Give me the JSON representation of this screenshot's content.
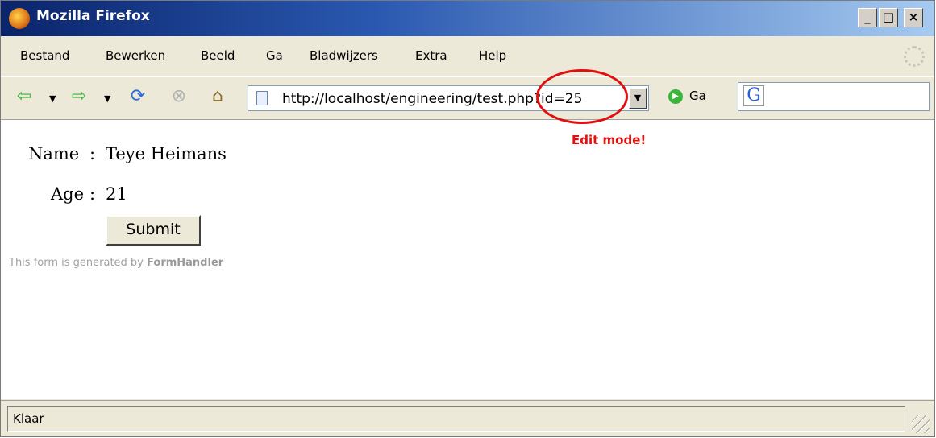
{
  "window": {
    "title": "Mozilla Firefox",
    "controls": {
      "minimize": "_",
      "maximize": "□",
      "close": "×"
    }
  },
  "menubar": {
    "items": [
      "Bestand",
      "Bewerken",
      "Beeld",
      "Ga",
      "Bladwijzers",
      "Extra",
      "Help"
    ]
  },
  "navbar": {
    "url": "http://localhost/engineering/test.php?id=25",
    "go_label": "Ga",
    "icons": [
      "back-icon",
      "forward-icon",
      "reload-icon",
      "stop-icon",
      "home-icon",
      "page-icon",
      "go-icon",
      "google-icon"
    ]
  },
  "form": {
    "name_label": "Name",
    "name_value": "Teye Heimans",
    "age_label": "Age",
    "age_value": "21",
    "separator": ":",
    "submit_label": "Submit",
    "generated_text": "This form is generated by",
    "generated_link": "FormHandler"
  },
  "annotation": {
    "text": "Edit mode!",
    "color": "#e01010"
  },
  "status": {
    "text": "Klaar"
  }
}
